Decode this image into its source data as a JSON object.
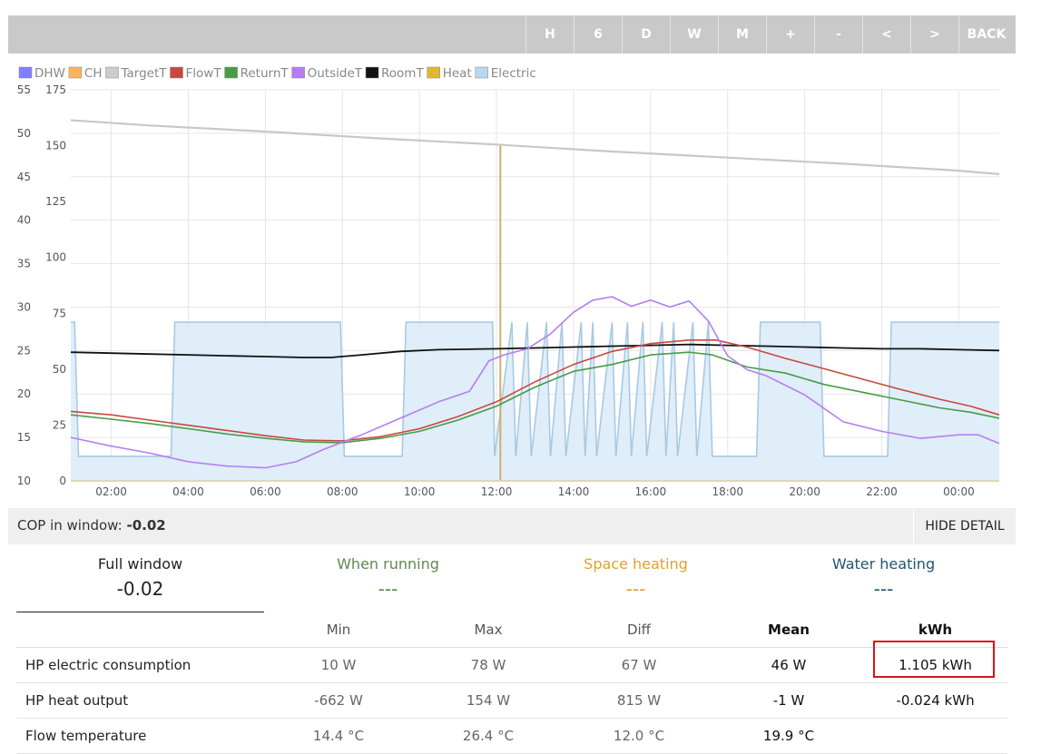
{
  "toolbar": {
    "buttons": [
      "H",
      "6",
      "D",
      "W",
      "M",
      "+",
      "-",
      "<",
      ">"
    ],
    "back_label": "BACK"
  },
  "chart_data": {
    "type": "line",
    "legend": [
      {
        "name": "DHW",
        "color": "#7f7fff"
      },
      {
        "name": "CH",
        "color": "#ffb35c"
      },
      {
        "name": "TargetT",
        "color": "#cccccc"
      },
      {
        "name": "FlowT",
        "color": "#c8473f"
      },
      {
        "name": "ReturnT",
        "color": "#479c47"
      },
      {
        "name": "OutsideT",
        "color": "#b77df0"
      },
      {
        "name": "RoomT",
        "color": "#111111"
      },
      {
        "name": "Heat",
        "color": "#e0b830"
      },
      {
        "name": "Electric",
        "color": "#b9d7ef"
      }
    ],
    "legend_position": "top-left",
    "grid": true,
    "x_ticks": [
      "02:00",
      "04:00",
      "06:00",
      "08:00",
      "10:00",
      "12:00",
      "14:00",
      "16:00",
      "18:00",
      "20:00",
      "22:00",
      "00:00"
    ],
    "x_tick_hours": [
      2,
      4,
      6,
      8,
      10,
      12,
      14,
      16,
      18,
      20,
      22,
      24
    ],
    "x_range_hours": [
      0.95,
      25.05
    ],
    "y_left_ticks": [
      10,
      15,
      20,
      25,
      30,
      35,
      40,
      45,
      50,
      55
    ],
    "y_left_range": [
      10,
      55
    ],
    "y_right_ticks": [
      0,
      25,
      50,
      75,
      100,
      125,
      150,
      175
    ],
    "y_right_range": [
      0,
      175
    ],
    "series": [
      {
        "name": "TargetT",
        "axis": "left",
        "color": "#c8c8c8",
        "width": 2.2,
        "x": [
          0.95,
          3,
          6,
          9,
          12,
          15,
          18,
          21,
          24,
          25.05
        ],
        "y": [
          51.5,
          50.9,
          50.2,
          49.4,
          48.7,
          47.9,
          47.2,
          46.5,
          45.7,
          45.3
        ]
      },
      {
        "name": "RoomT",
        "axis": "left",
        "color": "#111111",
        "width": 1.8,
        "x": [
          0.95,
          2,
          3,
          4,
          5,
          6,
          7,
          7.7,
          8.5,
          9.5,
          10.5,
          12,
          13,
          14,
          15,
          16,
          17,
          18,
          19,
          20,
          21,
          22,
          23,
          24,
          25.05
        ],
        "y": [
          24.8,
          24.7,
          24.6,
          24.5,
          24.4,
          24.3,
          24.2,
          24.2,
          24.5,
          24.9,
          25.1,
          25.2,
          25.3,
          25.4,
          25.5,
          25.6,
          25.7,
          25.6,
          25.5,
          25.4,
          25.3,
          25.2,
          25.2,
          25.1,
          25.0
        ]
      },
      {
        "name": "FlowT",
        "axis": "left",
        "color": "#c8473f",
        "width": 1.6,
        "x": [
          0.95,
          2,
          3,
          4,
          5,
          6,
          7,
          8,
          9,
          10,
          11,
          12,
          13,
          14,
          15,
          16,
          17,
          17.7,
          18.5,
          19.5,
          20.5,
          21.5,
          22.5,
          23.5,
          24.3,
          25.05
        ],
        "y": [
          18.0,
          17.6,
          17.0,
          16.4,
          15.8,
          15.2,
          14.7,
          14.6,
          15.1,
          16.0,
          17.4,
          19.1,
          21.4,
          23.4,
          24.9,
          25.8,
          26.2,
          26.2,
          25.4,
          24.1,
          22.9,
          21.7,
          20.5,
          19.4,
          18.6,
          17.6
        ]
      },
      {
        "name": "ReturnT",
        "axis": "left",
        "color": "#479c47",
        "width": 1.6,
        "x": [
          0.95,
          2,
          3,
          4,
          5,
          6,
          7,
          8,
          9,
          10,
          11,
          12,
          13,
          14,
          15,
          16,
          17,
          17.6,
          18.5,
          19.5,
          20.5,
          21.5,
          22.5,
          23.5,
          24.3,
          25.05
        ],
        "y": [
          17.6,
          17.1,
          16.6,
          16.0,
          15.4,
          14.9,
          14.5,
          14.4,
          14.9,
          15.7,
          17.0,
          18.6,
          20.8,
          22.6,
          23.4,
          24.5,
          24.8,
          24.5,
          23.1,
          22.4,
          21.1,
          20.2,
          19.3,
          18.4,
          17.9,
          17.2
        ]
      },
      {
        "name": "OutsideT",
        "axis": "left",
        "color": "#b77df0",
        "width": 1.6,
        "x": [
          0.95,
          2,
          3,
          4,
          5,
          6,
          6.8,
          7.5,
          8.5,
          9.5,
          10.5,
          11.3,
          11.8,
          12.2,
          12.8,
          13.4,
          14,
          14.5,
          15,
          15.5,
          16,
          16.5,
          17,
          17.5,
          18,
          18.5,
          19,
          20,
          21,
          22,
          23,
          24,
          24.5,
          25.05
        ],
        "y": [
          15.0,
          14.0,
          13.2,
          12.2,
          11.7,
          11.5,
          12.2,
          13.6,
          15.3,
          17.2,
          19.1,
          20.3,
          23.8,
          24.5,
          25.2,
          26.9,
          29.4,
          30.8,
          31.2,
          30.1,
          30.8,
          30.0,
          30.7,
          28.4,
          24.4,
          22.8,
          22.1,
          19.9,
          16.8,
          15.7,
          14.9,
          15.3,
          15.3,
          14.3
        ]
      },
      {
        "name": "Electric",
        "axis": "right",
        "color": "#a9c9e3",
        "fill": "#dcecf8",
        "width": 1.6,
        "x": [
          0.95,
          1.0,
          1.05,
          1.15,
          3.55,
          3.65,
          7.95,
          8.05,
          9.55,
          9.65,
          11.9,
          11.95,
          12.4,
          12.5,
          12.8,
          12.9,
          13.3,
          13.4,
          13.7,
          13.8,
          14.2,
          14.3,
          14.5,
          14.6,
          15.0,
          15.1,
          15.4,
          15.5,
          15.8,
          15.9,
          16.3,
          16.4,
          16.6,
          16.7,
          17.1,
          17.2,
          17.5,
          17.6,
          18.75,
          18.85,
          20.4,
          20.5,
          22.15,
          22.25,
          25.05
        ],
        "y": [
          71,
          71,
          71,
          11,
          11,
          71,
          71,
          11,
          11,
          71,
          71,
          11,
          71,
          11,
          71,
          11,
          71,
          11,
          71,
          11,
          71,
          11,
          71,
          11,
          71,
          11,
          71,
          11,
          71,
          11,
          71,
          11,
          71,
          11,
          71,
          11,
          71,
          11,
          11,
          71,
          71,
          11,
          11,
          71,
          71
        ]
      }
    ],
    "heat_marker_hour": 12.1
  },
  "cop": {
    "label": "COP in window:",
    "value": "-0.02",
    "hide_label": "HIDE DETAIL"
  },
  "tabs": [
    {
      "label": "Full window",
      "value": "-0.02",
      "color": "#222222"
    },
    {
      "label": "When running",
      "value": "---",
      "color": "#5e8a4e"
    },
    {
      "label": "Space heating",
      "value": "---",
      "color": "#e3a02e"
    },
    {
      "label": "Water heating",
      "value": "---",
      "color": "#1e5770"
    }
  ],
  "table": {
    "headers": [
      "",
      "Min",
      "Max",
      "Diff",
      "Mean",
      "kWh"
    ],
    "rows": [
      [
        "HP electric consumption",
        "10 W",
        "78 W",
        "67 W",
        "46 W",
        "1.105 kWh"
      ],
      [
        "HP heat output",
        "-662 W",
        "154 W",
        "815 W",
        "-1 W",
        "-0.024 kWh"
      ],
      [
        "Flow temperature",
        "14.4 °C",
        "26.4 °C",
        "12.0 °C",
        "19.9 °C",
        ""
      ]
    ]
  }
}
